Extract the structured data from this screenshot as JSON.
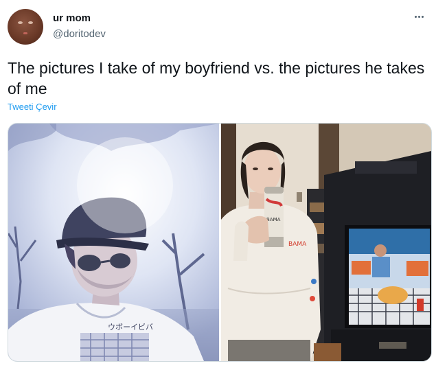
{
  "author": {
    "display_name": "ur mom",
    "handle": "@doritodev"
  },
  "tweet": {
    "text": "The pictures I take of my boyfriend vs. the pictures he takes of me",
    "translate_label": "Tweeti Çevir"
  },
  "media": {
    "photos": [
      {
        "description_icon": "boyfriend-photo",
        "shirt_text": "ウボーイビバ"
      },
      {
        "description_icon": "girlfriend-photo",
        "can_text": "BAMA"
      }
    ]
  },
  "icons": {
    "more": "more-dots-icon"
  },
  "colors": {
    "link": "#1d9bf0",
    "secondary_text": "#536471",
    "border": "#cfd9de"
  }
}
